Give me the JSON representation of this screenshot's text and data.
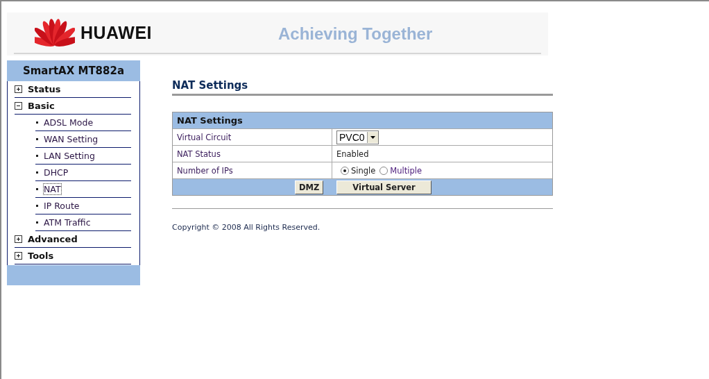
{
  "header": {
    "brand": "HUAWEI",
    "slogan": "Achieving Together"
  },
  "sidebar": {
    "title": "SmartAX MT882a",
    "items": [
      {
        "label": "Status",
        "expanded": false
      },
      {
        "label": "Basic",
        "expanded": true,
        "children": [
          {
            "label": "ADSL Mode",
            "selected": false
          },
          {
            "label": "WAN Setting",
            "selected": false
          },
          {
            "label": "LAN Setting",
            "selected": false
          },
          {
            "label": "DHCP",
            "selected": false
          },
          {
            "label": "NAT",
            "selected": true
          },
          {
            "label": "IP Route",
            "selected": false
          },
          {
            "label": "ATM Traffic",
            "selected": false
          }
        ]
      },
      {
        "label": "Advanced",
        "expanded": false
      },
      {
        "label": "Tools",
        "expanded": false
      }
    ]
  },
  "page_title": "NAT Settings",
  "panel": {
    "title": "NAT Settings",
    "rows": [
      {
        "kind": "select",
        "label": "Virtual Circuit",
        "value": "PVC0"
      },
      {
        "kind": "text",
        "label": "NAT Status",
        "value": "Enabled"
      },
      {
        "kind": "radio",
        "label": "Number of IPs",
        "options": [
          {
            "label": "Single",
            "selected": true
          },
          {
            "label": "Multiple",
            "selected": false
          }
        ]
      }
    ],
    "buttons": [
      "DMZ",
      "Virtual Server"
    ]
  },
  "copyright": "Copyright © 2008 All Rights Reserved."
}
